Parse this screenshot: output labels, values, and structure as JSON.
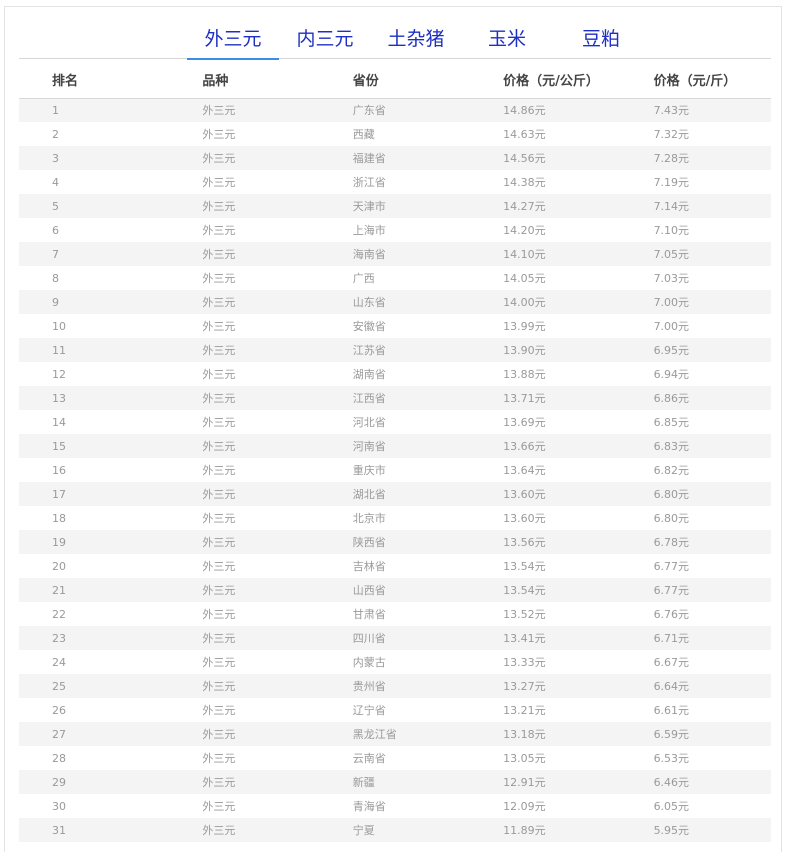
{
  "tabs": [
    {
      "label": "外三元"
    },
    {
      "label": "内三元"
    },
    {
      "label": "土杂猪"
    },
    {
      "label": "玉米"
    },
    {
      "label": "豆粕"
    }
  ],
  "table": {
    "headers": [
      "排名",
      "品种",
      "省份",
      "价格（元/公斤）",
      "价格（元/斤）"
    ],
    "rows": [
      [
        "1",
        "外三元",
        "广东省",
        "14.86元",
        "7.43元"
      ],
      [
        "2",
        "外三元",
        "西藏",
        "14.63元",
        "7.32元"
      ],
      [
        "3",
        "外三元",
        "福建省",
        "14.56元",
        "7.28元"
      ],
      [
        "4",
        "外三元",
        "浙江省",
        "14.38元",
        "7.19元"
      ],
      [
        "5",
        "外三元",
        "天津市",
        "14.27元",
        "7.14元"
      ],
      [
        "6",
        "外三元",
        "上海市",
        "14.20元",
        "7.10元"
      ],
      [
        "7",
        "外三元",
        "海南省",
        "14.10元",
        "7.05元"
      ],
      [
        "8",
        "外三元",
        "广西",
        "14.05元",
        "7.03元"
      ],
      [
        "9",
        "外三元",
        "山东省",
        "14.00元",
        "7.00元"
      ],
      [
        "10",
        "外三元",
        "安徽省",
        "13.99元",
        "7.00元"
      ],
      [
        "11",
        "外三元",
        "江苏省",
        "13.90元",
        "6.95元"
      ],
      [
        "12",
        "外三元",
        "湖南省",
        "13.88元",
        "6.94元"
      ],
      [
        "13",
        "外三元",
        "江西省",
        "13.71元",
        "6.86元"
      ],
      [
        "14",
        "外三元",
        "河北省",
        "13.69元",
        "6.85元"
      ],
      [
        "15",
        "外三元",
        "河南省",
        "13.66元",
        "6.83元"
      ],
      [
        "16",
        "外三元",
        "重庆市",
        "13.64元",
        "6.82元"
      ],
      [
        "17",
        "外三元",
        "湖北省",
        "13.60元",
        "6.80元"
      ],
      [
        "18",
        "外三元",
        "北京市",
        "13.60元",
        "6.80元"
      ],
      [
        "19",
        "外三元",
        "陕西省",
        "13.56元",
        "6.78元"
      ],
      [
        "20",
        "外三元",
        "吉林省",
        "13.54元",
        "6.77元"
      ],
      [
        "21",
        "外三元",
        "山西省",
        "13.54元",
        "6.77元"
      ],
      [
        "22",
        "外三元",
        "甘肃省",
        "13.52元",
        "6.76元"
      ],
      [
        "23",
        "外三元",
        "四川省",
        "13.41元",
        "6.71元"
      ],
      [
        "24",
        "外三元",
        "内蒙古",
        "13.33元",
        "6.67元"
      ],
      [
        "25",
        "外三元",
        "贵州省",
        "13.27元",
        "6.64元"
      ],
      [
        "26",
        "外三元",
        "辽宁省",
        "13.21元",
        "6.61元"
      ],
      [
        "27",
        "外三元",
        "黑龙江省",
        "13.18元",
        "6.59元"
      ],
      [
        "28",
        "外三元",
        "云南省",
        "13.05元",
        "6.53元"
      ],
      [
        "29",
        "外三元",
        "新疆",
        "12.91元",
        "6.46元"
      ],
      [
        "30",
        "外三元",
        "青海省",
        "12.09元",
        "6.05元"
      ],
      [
        "31",
        "外三元",
        "宁夏",
        "11.89元",
        "5.95元"
      ]
    ]
  },
  "colors": {
    "tab_text": "#1f2fc4",
    "tab_underline": "#3a8ee6",
    "row_stripe": "#f4f4f4",
    "cell_text": "#9a9a9a"
  }
}
